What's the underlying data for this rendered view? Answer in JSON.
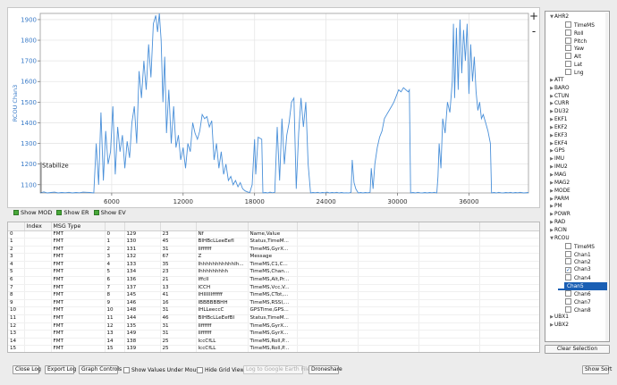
{
  "chart_data": {
    "type": "line",
    "ylabel": "RCOU Chan3",
    "xlim": [
      0,
      41000
    ],
    "ylim": [
      1060,
      1930
    ],
    "x_ticks": [
      6000,
      12000,
      18000,
      24000,
      30000,
      36000
    ],
    "y_ticks": [
      1100,
      1200,
      1300,
      1400,
      1500,
      1600,
      1700,
      1800,
      1900
    ],
    "grid": true,
    "line_color": "#4a90d9",
    "annotations": [
      {
        "text": "Stabilize",
        "x": 0,
        "y": 1200
      }
    ],
    "series": [
      {
        "points": [
          [
            0,
            1060
          ],
          [
            300,
            1065
          ],
          [
            600,
            1060
          ],
          [
            900,
            1062
          ],
          [
            1200,
            1064
          ],
          [
            1500,
            1060
          ],
          [
            1800,
            1062
          ],
          [
            2100,
            1061
          ],
          [
            2400,
            1063
          ],
          [
            2700,
            1060
          ],
          [
            3000,
            1062
          ],
          [
            3300,
            1061
          ],
          [
            3600,
            1064
          ],
          [
            3900,
            1063
          ],
          [
            4200,
            1062
          ],
          [
            4500,
            1060
          ],
          [
            4700,
            1300
          ],
          [
            4900,
            1100
          ],
          [
            5100,
            1450
          ],
          [
            5300,
            1120
          ],
          [
            5500,
            1360
          ],
          [
            5700,
            1200
          ],
          [
            5900,
            1260
          ],
          [
            6100,
            1480
          ],
          [
            6300,
            1150
          ],
          [
            6500,
            1380
          ],
          [
            6700,
            1260
          ],
          [
            6900,
            1340
          ],
          [
            7100,
            1180
          ],
          [
            7300,
            1310
          ],
          [
            7500,
            1230
          ],
          [
            7700,
            1400
          ],
          [
            7900,
            1480
          ],
          [
            8100,
            1300
          ],
          [
            8300,
            1650
          ],
          [
            8500,
            1520
          ],
          [
            8700,
            1700
          ],
          [
            8900,
            1560
          ],
          [
            9100,
            1780
          ],
          [
            9300,
            1620
          ],
          [
            9500,
            1880
          ],
          [
            9700,
            1920
          ],
          [
            9850,
            1840
          ],
          [
            10000,
            1930
          ],
          [
            10150,
            1800
          ],
          [
            10300,
            1500
          ],
          [
            10450,
            1720
          ],
          [
            10600,
            1350
          ],
          [
            10800,
            1560
          ],
          [
            11000,
            1300
          ],
          [
            11200,
            1480
          ],
          [
            11400,
            1280
          ],
          [
            11600,
            1340
          ],
          [
            11800,
            1220
          ],
          [
            12000,
            1280
          ],
          [
            12200,
            1180
          ],
          [
            12400,
            1300
          ],
          [
            12600,
            1260
          ],
          [
            12800,
            1400
          ],
          [
            13000,
            1350
          ],
          [
            13200,
            1320
          ],
          [
            13400,
            1360
          ],
          [
            13600,
            1440
          ],
          [
            13800,
            1420
          ],
          [
            14000,
            1430
          ],
          [
            14200,
            1380
          ],
          [
            14400,
            1410
          ],
          [
            14600,
            1220
          ],
          [
            14800,
            1300
          ],
          [
            15000,
            1180
          ],
          [
            15200,
            1260
          ],
          [
            15400,
            1150
          ],
          [
            15600,
            1200
          ],
          [
            15800,
            1120
          ],
          [
            16000,
            1140
          ],
          [
            16200,
            1100
          ],
          [
            16400,
            1120
          ],
          [
            16600,
            1090
          ],
          [
            16800,
            1110
          ],
          [
            17000,
            1080
          ],
          [
            17200,
            1070
          ],
          [
            17400,
            1065
          ],
          [
            17600,
            1062
          ],
          [
            17800,
            1100
          ],
          [
            18000,
            1320
          ],
          [
            18100,
            1150
          ],
          [
            18300,
            1330
          ],
          [
            18600,
            1320
          ],
          [
            18700,
            1060
          ],
          [
            18900,
            1062
          ],
          [
            19100,
            1060
          ],
          [
            19300,
            1064
          ],
          [
            19500,
            1061
          ],
          [
            19700,
            1063
          ],
          [
            19900,
            1380
          ],
          [
            20100,
            1120
          ],
          [
            20300,
            1420
          ],
          [
            20500,
            1200
          ],
          [
            20700,
            1340
          ],
          [
            20900,
            1400
          ],
          [
            21100,
            1500
          ],
          [
            21300,
            1520
          ],
          [
            21500,
            1080
          ],
          [
            21700,
            1350
          ],
          [
            21900,
            1520
          ],
          [
            22100,
            1380
          ],
          [
            22300,
            1500
          ],
          [
            22500,
            1200
          ],
          [
            22700,
            1060
          ],
          [
            22900,
            1062
          ],
          [
            23100,
            1061
          ],
          [
            23300,
            1063
          ],
          [
            23500,
            1060
          ],
          [
            23700,
            1062
          ],
          [
            23900,
            1061
          ],
          [
            24100,
            1064
          ],
          [
            24300,
            1060
          ],
          [
            24500,
            1062
          ],
          [
            24700,
            1061
          ],
          [
            24900,
            1063
          ],
          [
            25100,
            1060
          ],
          [
            25300,
            1062
          ],
          [
            25500,
            1060
          ],
          [
            25700,
            1061
          ],
          [
            25900,
            1060
          ],
          [
            26100,
            1063
          ],
          [
            26200,
            1220
          ],
          [
            26350,
            1110
          ],
          [
            26500,
            1080
          ],
          [
            26700,
            1060
          ],
          [
            26900,
            1062
          ],
          [
            27100,
            1060
          ],
          [
            27300,
            1062
          ],
          [
            27500,
            1061
          ],
          [
            27700,
            1063
          ],
          [
            27800,
            1180
          ],
          [
            27950,
            1080
          ],
          [
            28100,
            1200
          ],
          [
            28300,
            1280
          ],
          [
            28500,
            1330
          ],
          [
            28700,
            1360
          ],
          [
            28900,
            1420
          ],
          [
            29100,
            1440
          ],
          [
            29300,
            1460
          ],
          [
            29500,
            1480
          ],
          [
            29700,
            1500
          ],
          [
            29900,
            1530
          ],
          [
            30100,
            1560
          ],
          [
            30300,
            1550
          ],
          [
            30500,
            1570
          ],
          [
            30700,
            1560
          ],
          [
            30900,
            1550
          ],
          [
            31000,
            1560
          ],
          [
            31100,
            1060
          ],
          [
            31300,
            1062
          ],
          [
            31500,
            1060
          ],
          [
            31700,
            1063
          ],
          [
            31900,
            1061
          ],
          [
            32100,
            1060
          ],
          [
            32300,
            1062
          ],
          [
            32500,
            1060
          ],
          [
            32700,
            1062
          ],
          [
            32900,
            1061
          ],
          [
            33100,
            1063
          ],
          [
            33300,
            1060
          ],
          [
            33400,
            1140
          ],
          [
            33500,
            1300
          ],
          [
            33650,
            1180
          ],
          [
            33800,
            1420
          ],
          [
            34000,
            1350
          ],
          [
            34200,
            1500
          ],
          [
            34400,
            1450
          ],
          [
            34600,
            1600
          ],
          [
            34700,
            1880
          ],
          [
            34800,
            1520
          ],
          [
            34950,
            1860
          ],
          [
            35100,
            1560
          ],
          [
            35250,
            1900
          ],
          [
            35400,
            1640
          ],
          [
            35550,
            1850
          ],
          [
            35700,
            1700
          ],
          [
            35850,
            1880
          ],
          [
            36000,
            1540
          ],
          [
            36150,
            1780
          ],
          [
            36300,
            1600
          ],
          [
            36450,
            1720
          ],
          [
            36600,
            1550
          ],
          [
            36750,
            1460
          ],
          [
            36900,
            1500
          ],
          [
            37050,
            1420
          ],
          [
            37200,
            1440
          ],
          [
            37400,
            1400
          ],
          [
            37600,
            1360
          ],
          [
            37800,
            1300
          ],
          [
            37900,
            1060
          ],
          [
            38100,
            1062
          ],
          [
            38300,
            1060
          ],
          [
            38500,
            1063
          ],
          [
            38700,
            1061
          ],
          [
            38900,
            1060
          ],
          [
            39100,
            1062
          ],
          [
            39300,
            1061
          ],
          [
            39500,
            1063
          ],
          [
            39700,
            1060
          ],
          [
            39900,
            1062
          ],
          [
            40100,
            1061
          ],
          [
            40300,
            1063
          ],
          [
            40600,
            1060
          ],
          [
            41000,
            1062
          ]
        ]
      }
    ]
  },
  "chart_controls": {
    "plus": "+",
    "minus": "-"
  },
  "toggles": [
    "Show MOD",
    "Show ER",
    "Show EV"
  ],
  "table": {
    "headers": [
      "",
      "Index",
      "MSG Type",
      "",
      "",
      "",
      "",
      "",
      "",
      "",
      "",
      "",
      ""
    ],
    "rows": [
      [
        "0",
        "",
        "FMT",
        "0",
        "129",
        "23",
        "Nf",
        "",
        "Name,Value",
        "",
        "",
        "",
        ""
      ],
      [
        "1",
        "",
        "FMT",
        "1",
        "130",
        "45",
        "BIHBcLLeeEefI",
        "",
        "Status,TimeM...",
        "",
        "",
        "",
        ""
      ],
      [
        "2",
        "",
        "FMT",
        "2",
        "131",
        "31",
        "IIffffff",
        "",
        "TimeMS,GyrX...",
        "",
        "",
        "",
        ""
      ],
      [
        "3",
        "",
        "FMT",
        "3",
        "132",
        "67",
        "Z",
        "",
        "Message",
        "",
        "",
        "",
        ""
      ],
      [
        "4",
        "",
        "FMT",
        "4",
        "133",
        "35",
        "IhhhhhhhhhhhIh...",
        "",
        "TimeMS,C1,C...",
        "",
        "",
        "",
        ""
      ],
      [
        "5",
        "",
        "FMT",
        "5",
        "134",
        "23",
        "Ihhhhhhhhh",
        "",
        "TimeMS,Chan...",
        "",
        "",
        "",
        ""
      ],
      [
        "6",
        "",
        "FMT",
        "6",
        "136",
        "21",
        "IffcII",
        "",
        "TimeMS,Alt,Pr...",
        "",
        "",
        "",
        ""
      ],
      [
        "7",
        "",
        "FMT",
        "7",
        "137",
        "13",
        "ICCH",
        "",
        "TimeMS,Vcc,V...",
        "",
        "",
        "",
        ""
      ],
      [
        "8",
        "",
        "FMT",
        "8",
        "145",
        "41",
        "IHIIIIIIffffff",
        "",
        "TimeMS,CTot,...",
        "",
        "",
        "",
        ""
      ],
      [
        "9",
        "",
        "FMT",
        "9",
        "146",
        "16",
        "IBBBBBBHH",
        "",
        "TimeMS,RSSI,...",
        "",
        "",
        "",
        ""
      ],
      [
        "10",
        "",
        "FMT",
        "10",
        "148",
        "31",
        "IHLLeeccC",
        "",
        "GPSTime,GPS...",
        "",
        "",
        "",
        ""
      ],
      [
        "11",
        "",
        "FMT",
        "11",
        "144",
        "46",
        "BIHBcLLeEefBI",
        "",
        "Status,TimeM...",
        "",
        "",
        "",
        ""
      ],
      [
        "12",
        "",
        "FMT",
        "12",
        "135",
        "31",
        "IIffffff",
        "",
        "TimeMS,GyrX...",
        "",
        "",
        "",
        ""
      ],
      [
        "13",
        "",
        "FMT",
        "13",
        "149",
        "31",
        "IIffffff",
        "",
        "TimeMS,GyrX...",
        "",
        "",
        "",
        ""
      ],
      [
        "14",
        "",
        "FMT",
        "14",
        "138",
        "25",
        "IccCfLL",
        "",
        "TimeMS,Roll,P...",
        "",
        "",
        "",
        ""
      ],
      [
        "15",
        "",
        "FMT",
        "15",
        "139",
        "25",
        "IccCfLL",
        "",
        "TimeMS,Roll,P...",
        "",
        "",
        "",
        ""
      ],
      [
        "16",
        "",
        "FMT",
        "16",
        "140",
        "43",
        "IccCffffffccc",
        "",
        "TimeMS,Roll,P...",
        "",
        "",
        "",
        ""
      ],
      [
        "17",
        "",
        "FMT",
        "17",
        "141",
        "26",
        "Ihhbcchhhhhhh",
        "",
        "TimeMS,AX,A...",
        "",
        "",
        "",
        ""
      ]
    ]
  },
  "tree": {
    "ahr2": {
      "label": "AHR2",
      "children": [
        "TimeMS",
        "Roll",
        "Pitch",
        "Yaw",
        "Alt",
        "Lat",
        "Lng"
      ]
    },
    "collapsed_a": [
      "ATT",
      "BARO",
      "CTUN",
      "CURR",
      "DU32",
      "EKF1",
      "EKF2",
      "EKF3",
      "EKF4",
      "GPS",
      "IMU",
      "IMU2",
      "MAG",
      "MAG2",
      "MODE",
      "PARM",
      "PM",
      "POWR",
      "RAD",
      "RCIN"
    ],
    "rcou": {
      "label": "RCOU",
      "children": [
        {
          "label": "TimeMS",
          "checked": false,
          "selected": false
        },
        {
          "label": "Chan1",
          "checked": false,
          "selected": false
        },
        {
          "label": "Chan2",
          "checked": false,
          "selected": false
        },
        {
          "label": "Chan3",
          "checked": true,
          "selected": false
        },
        {
          "label": "Chan4",
          "checked": false,
          "selected": false
        },
        {
          "label": "Chan5",
          "checked": false,
          "selected": true
        },
        {
          "label": "Chan6",
          "checked": false,
          "selected": false
        },
        {
          "label": "Chan7",
          "checked": false,
          "selected": false
        },
        {
          "label": "Chan8",
          "checked": false,
          "selected": false
        }
      ]
    },
    "collapsed_b": [
      "UBX1",
      "UBX2"
    ]
  },
  "clear_selection": "Clear Selection",
  "bottom": {
    "close_log": "Close Log",
    "export_log": "Export Log",
    "graph_controls": "Graph Controls",
    "show_values": "Show Values Under Mouse",
    "hide_grid": "Hide Grid View",
    "log_to_google_earth": "Log to Google Earth File",
    "droneshare": "Droneshare",
    "show_sort": "Show Sort"
  }
}
